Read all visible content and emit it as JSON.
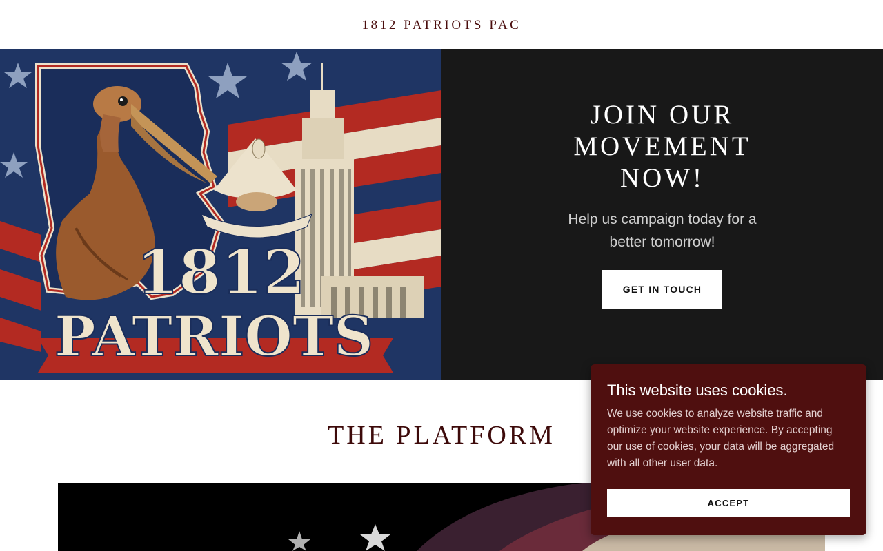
{
  "header": {
    "site_title": "1812 PATRIOTS PAC"
  },
  "hero": {
    "image_text_line1": "1812",
    "image_text_line2": "PATRIOTS",
    "heading": "JOIN OUR MOVEMENT NOW!",
    "subtitle": "Help us campaign today for a better tomorrow!",
    "cta_label": "GET IN TOUCH"
  },
  "platform": {
    "title": "THE PLATFORM"
  },
  "cookie_banner": {
    "title": "This website uses cookies.",
    "body": "We use cookies to analyze website traffic and optimize your website experience. By accepting our use of cookies, your data will be aggregated with all other user data.",
    "accept_label": "ACCEPT"
  },
  "colors": {
    "brand": "#4a0d0d",
    "hero_panel": "#181818",
    "cookie_bg": "#4f0f0f"
  }
}
